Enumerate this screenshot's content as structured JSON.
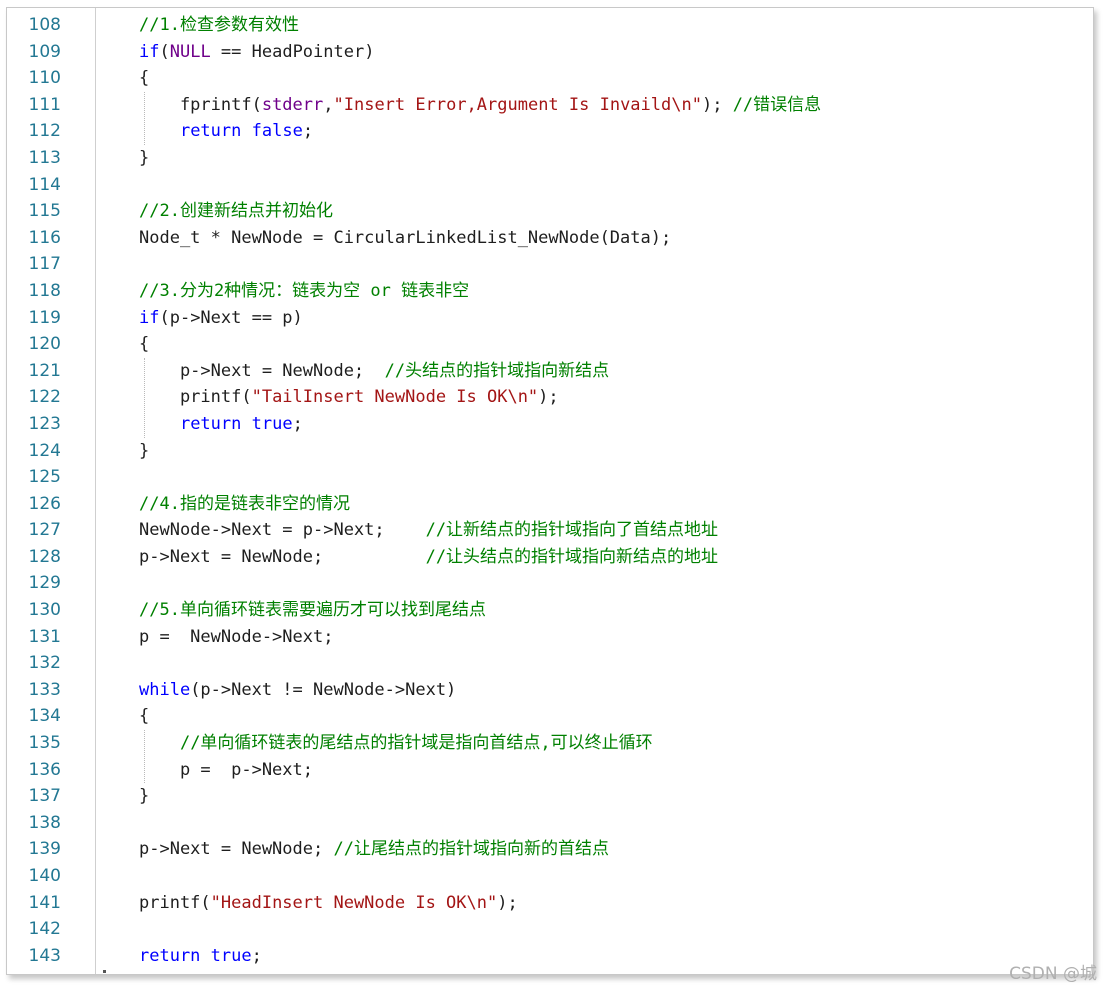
{
  "editor": {
    "lines": [
      {
        "n": "108",
        "t": [
          [
            "cm",
            "//1.检查参数有效性"
          ]
        ]
      },
      {
        "n": "109",
        "t": [
          [
            "kw",
            "if"
          ],
          [
            "",
            "("
          ],
          [
            "macro",
            "NULL"
          ],
          [
            "",
            " == HeadPointer)"
          ]
        ]
      },
      {
        "n": "110",
        "t": [
          [
            "",
            "{"
          ]
        ]
      },
      {
        "n": "111",
        "t": [
          [
            "",
            "    fprintf("
          ],
          [
            "macro",
            "stderr"
          ],
          [
            "",
            ","
          ],
          [
            "str",
            "\"Insert Error,Argument Is Invaild\\n\""
          ],
          [
            "",
            "); "
          ],
          [
            "cm",
            "//错误信息"
          ]
        ]
      },
      {
        "n": "112",
        "t": [
          [
            "",
            "    "
          ],
          [
            "kw",
            "return"
          ],
          [
            "",
            " "
          ],
          [
            "kw",
            "false"
          ],
          [
            "",
            ";"
          ]
        ]
      },
      {
        "n": "113",
        "t": [
          [
            "",
            "}"
          ]
        ]
      },
      {
        "n": "114",
        "t": []
      },
      {
        "n": "115",
        "t": [
          [
            "cm",
            "//2.创建新结点并初始化"
          ]
        ]
      },
      {
        "n": "116",
        "t": [
          [
            "",
            "Node_t * NewNode = CircularLinkedList_NewNode(Data);"
          ]
        ]
      },
      {
        "n": "117",
        "t": []
      },
      {
        "n": "118",
        "t": [
          [
            "cm",
            "//3.分为2种情况：链表为空 or 链表非空"
          ]
        ]
      },
      {
        "n": "119",
        "t": [
          [
            "kw",
            "if"
          ],
          [
            "",
            "(p->Next == p)"
          ]
        ]
      },
      {
        "n": "120",
        "t": [
          [
            "",
            "{"
          ]
        ]
      },
      {
        "n": "121",
        "t": [
          [
            "",
            "    p->Next = NewNode;  "
          ],
          [
            "cm",
            "//头结点的指针域指向新结点"
          ]
        ]
      },
      {
        "n": "122",
        "t": [
          [
            "",
            "    printf("
          ],
          [
            "str",
            "\"TailInsert NewNode Is OK\\n\""
          ],
          [
            "",
            ");"
          ]
        ]
      },
      {
        "n": "123",
        "t": [
          [
            "",
            "    "
          ],
          [
            "kw",
            "return"
          ],
          [
            "",
            " "
          ],
          [
            "kw",
            "true"
          ],
          [
            "",
            ";"
          ]
        ]
      },
      {
        "n": "124",
        "t": [
          [
            "",
            "}"
          ]
        ]
      },
      {
        "n": "125",
        "t": []
      },
      {
        "n": "126",
        "t": [
          [
            "cm",
            "//4.指的是链表非空的情况"
          ]
        ]
      },
      {
        "n": "127",
        "t": [
          [
            "",
            "NewNode->Next = p->Next;    "
          ],
          [
            "cm",
            "//让新结点的指针域指向了首结点地址"
          ]
        ]
      },
      {
        "n": "128",
        "t": [
          [
            "",
            "p->Next = NewNode;          "
          ],
          [
            "cm",
            "//让头结点的指针域指向新结点的地址"
          ]
        ]
      },
      {
        "n": "129",
        "t": []
      },
      {
        "n": "130",
        "t": [
          [
            "cm",
            "//5.单向循环链表需要遍历才可以找到尾结点"
          ]
        ]
      },
      {
        "n": "131",
        "t": [
          [
            "",
            "p =  NewNode->Next;"
          ]
        ]
      },
      {
        "n": "132",
        "t": []
      },
      {
        "n": "133",
        "t": [
          [
            "kw",
            "while"
          ],
          [
            "",
            "(p->Next != NewNode->Next)"
          ]
        ]
      },
      {
        "n": "134",
        "t": [
          [
            "",
            "{"
          ]
        ]
      },
      {
        "n": "135",
        "t": [
          [
            "",
            "    "
          ],
          [
            "cm",
            "//单向循环链表的尾结点的指针域是指向首结点,可以终止循环"
          ]
        ]
      },
      {
        "n": "136",
        "t": [
          [
            "",
            "    p =  p->Next;"
          ]
        ]
      },
      {
        "n": "137",
        "t": [
          [
            "",
            "}"
          ]
        ]
      },
      {
        "n": "138",
        "t": []
      },
      {
        "n": "139",
        "t": [
          [
            "",
            "p->Next = NewNode; "
          ],
          [
            "cm",
            "//让尾结点的指针域指向新的首结点"
          ]
        ]
      },
      {
        "n": "140",
        "t": []
      },
      {
        "n": "141",
        "t": [
          [
            "",
            "printf("
          ],
          [
            "str",
            "\"HeadInsert NewNode Is OK\\n\""
          ],
          [
            "",
            ");"
          ]
        ]
      },
      {
        "n": "142",
        "t": []
      },
      {
        "n": "143",
        "t": [
          [
            "kw",
            "return"
          ],
          [
            "",
            " "
          ],
          [
            "kw",
            "true"
          ],
          [
            "",
            ";"
          ]
        ]
      }
    ]
  },
  "watermark": "CSDN @城",
  "colors": {
    "keyword": "#0000ff",
    "string": "#a31515",
    "comment": "#008000",
    "macro": "#6f008a",
    "line_number": "#237893"
  }
}
